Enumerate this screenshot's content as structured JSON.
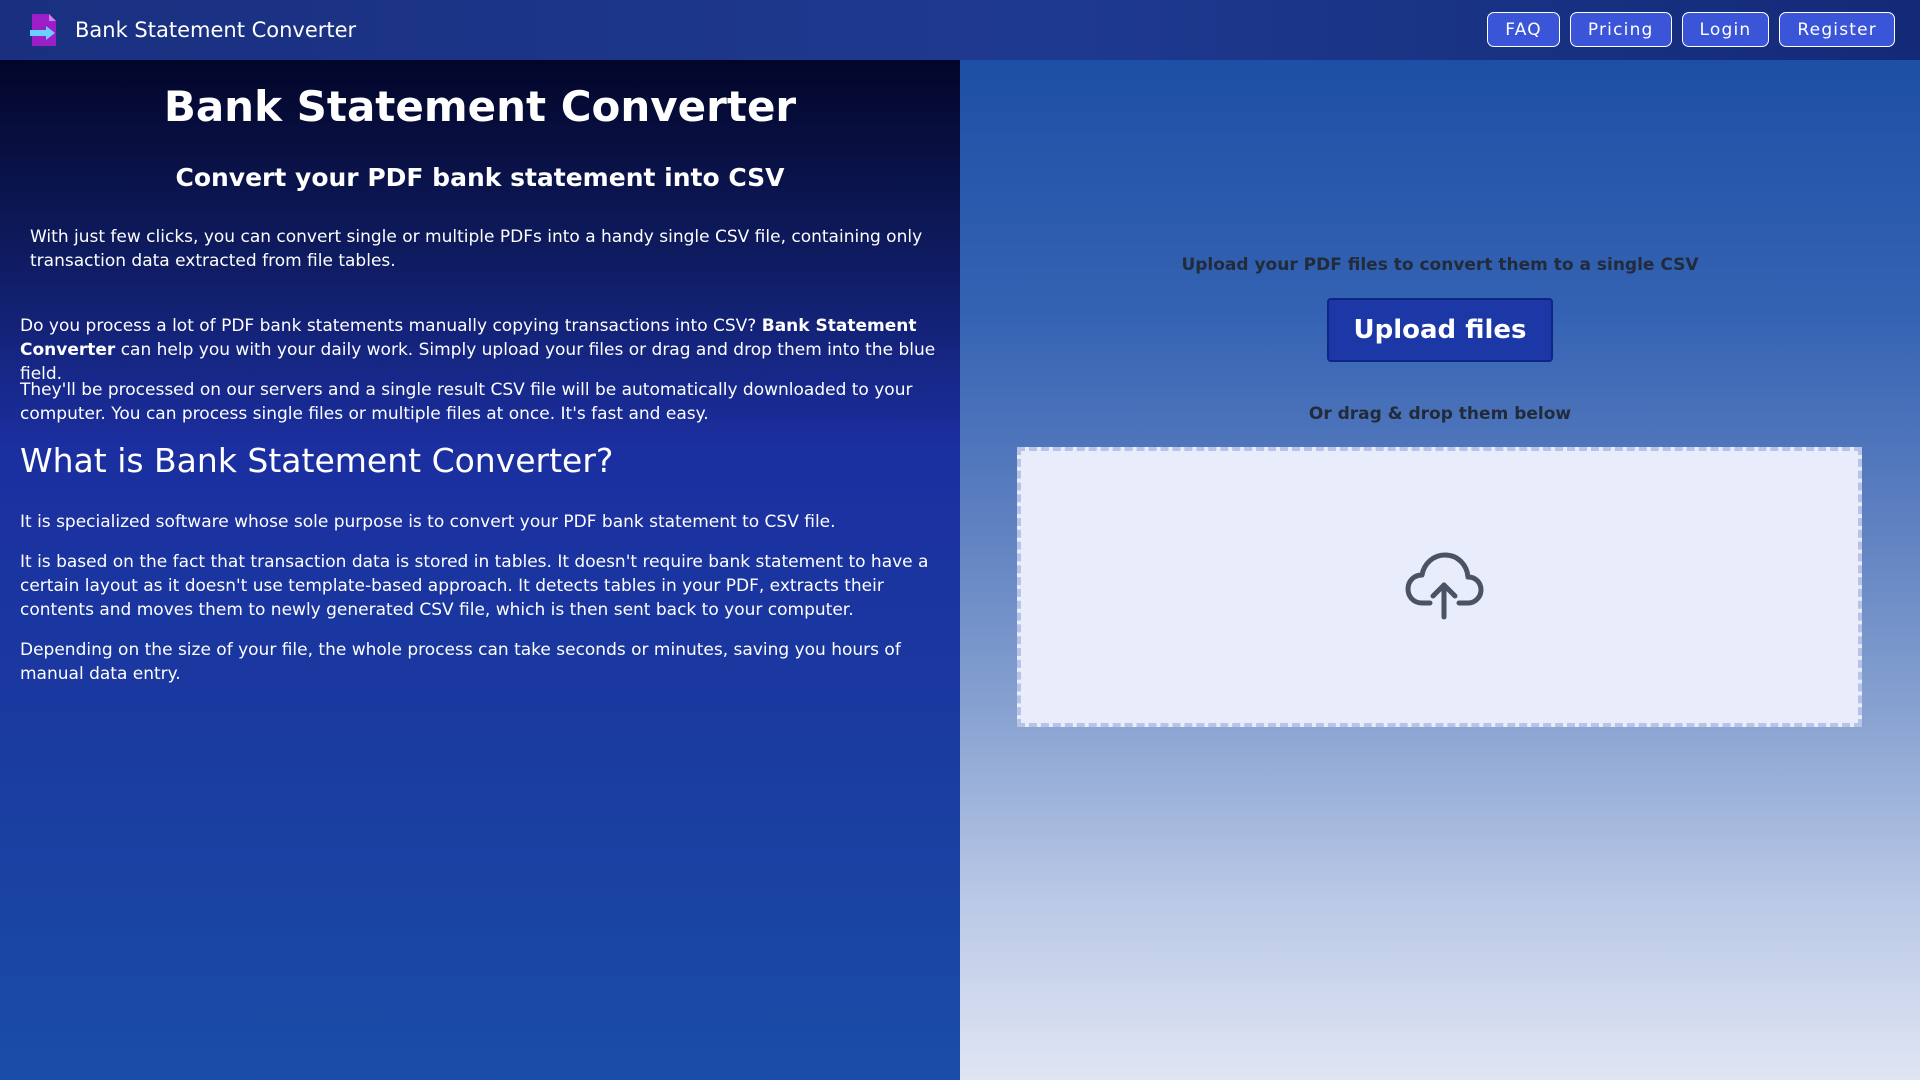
{
  "header": {
    "brand": "Bank Statement Converter",
    "nav": [
      "FAQ",
      "Pricing",
      "Login",
      "Register"
    ]
  },
  "left": {
    "title": "Bank Statement Converter",
    "subtitle": "Convert your PDF bank statement into CSV",
    "intro": "With just few clicks, you can convert single or multiple PDFs into a handy single CSV file, containing only transaction data extracted from file tables.",
    "p1_before": "Do you process a lot of PDF bank statements manually copying transactions into CSV? ",
    "p1_bold": "Bank Statement Converter",
    "p1_after": " can help you with your daily work. Simply upload your files or drag and drop them into the blue field.",
    "p2": "They'll be processed on our servers and a single result CSV file will be automatically downloaded to your computer. You can process single files or multiple files at once. It's fast and easy.",
    "h2": "What is Bank Statement Converter?",
    "p3": "It is specialized software whose sole purpose is to convert your PDF bank statement to CSV file.",
    "p4": "It is based on the fact that transaction data is stored in tables. It doesn't require bank statement to have a certain layout as it doesn't use template-based approach. It detects tables in your PDF, extracts their contents and moves them to newly generated CSV file, which is then sent back to your computer.",
    "p5": "Depending on the size of your file, the whole process can take seconds or minutes, saving you hours of manual data entry."
  },
  "right": {
    "upload_label": "Upload your PDF files to convert them to a single CSV",
    "upload_button": "Upload files",
    "drag_label": "Or drag & drop them below",
    "drop_icon": "cloud-upload-icon"
  },
  "colors": {
    "nav_button": "#3a55d8",
    "upload_button": "#1c37a6",
    "dropzone": "#e9ecfa"
  }
}
